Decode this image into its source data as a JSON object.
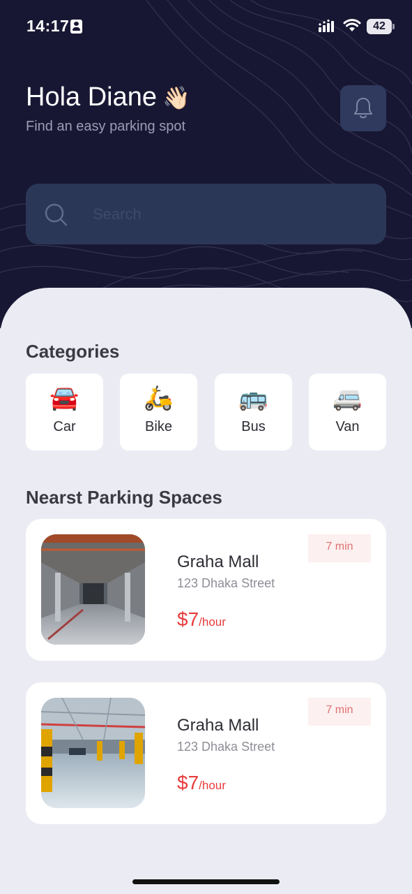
{
  "status_bar": {
    "time": "14:17",
    "battery": "42"
  },
  "header": {
    "greeting": "Hola Diane",
    "subtitle": "Find an easy parking spot"
  },
  "search": {
    "placeholder": "Search"
  },
  "categories": {
    "title": "Categories",
    "items": [
      {
        "label": "Car",
        "emoji": "🚘"
      },
      {
        "label": "Bike",
        "emoji": "🛵"
      },
      {
        "label": "Bus",
        "emoji": "🚌"
      },
      {
        "label": "Van",
        "emoji": "🚐"
      }
    ]
  },
  "parking": {
    "title": "Nearst Parking Spaces",
    "items": [
      {
        "name": "Graha Mall",
        "address": "123 Dhaka Street",
        "price": "$7",
        "unit": "/hour",
        "time": "7 min"
      },
      {
        "name": "Graha Mall",
        "address": "123 Dhaka Street",
        "price": "$7",
        "unit": "/hour",
        "time": "7 min"
      }
    ]
  },
  "colors": {
    "header_bg": "#181733",
    "accent_red": "#e83b3b",
    "sheet_bg": "#ebecf3",
    "search_bg": "#2b3757"
  }
}
